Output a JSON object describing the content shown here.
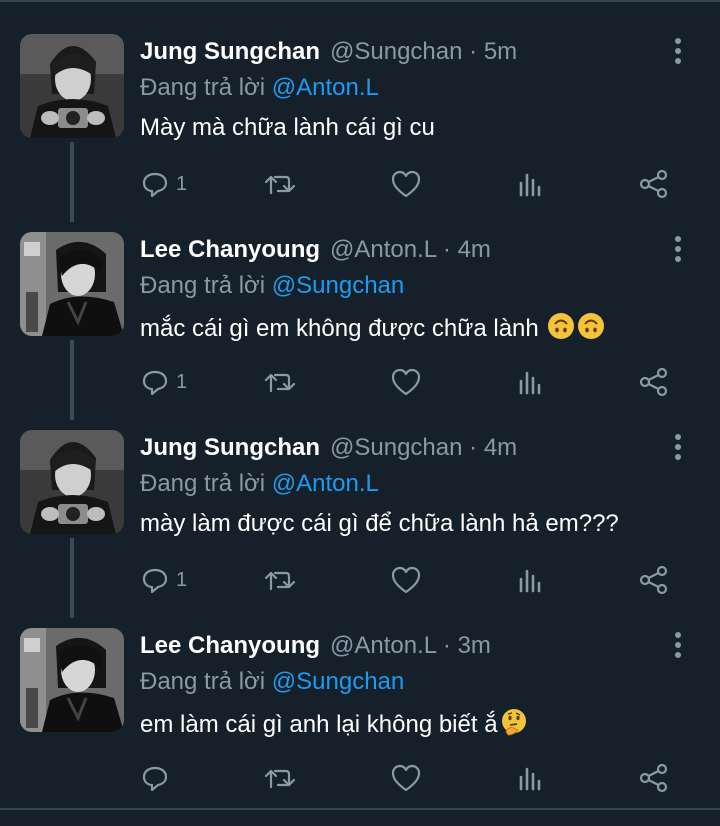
{
  "tweets": [
    {
      "name": "Jung Sungchan",
      "handle": "@Sungchan",
      "time": "5m",
      "reply_prefix": "Đang trả lời",
      "reply_to": "@Anton.L",
      "text": "Mày mà chữa lành cái gì cu",
      "reply_count": "1",
      "avatar": "person-with-camera"
    },
    {
      "name": "Lee Chanyoung",
      "handle": "@Anton.L",
      "time": "4m",
      "reply_prefix": "Đang trả lời",
      "reply_to": "@Sungchan",
      "text": "mắc cái gì em không được chữa lành",
      "emojis": [
        "upside-down-face",
        "upside-down-face"
      ],
      "reply_count": "1",
      "avatar": "person-in-jacket"
    },
    {
      "name": "Jung Sungchan",
      "handle": "@Sungchan",
      "time": "4m",
      "reply_prefix": "Đang trả lời",
      "reply_to": "@Anton.L",
      "text": "mày làm được cái gì để chữa lành hả em???",
      "reply_count": "1",
      "avatar": "person-with-camera"
    },
    {
      "name": "Lee Chanyoung",
      "handle": "@Anton.L",
      "time": "3m",
      "reply_prefix": "Đang trả lời",
      "reply_to": "@Sungchan",
      "text": "em làm cái gì anh lại không biết ắ",
      "emojis": [
        "thinking-face"
      ],
      "reply_count": "",
      "avatar": "person-in-jacket"
    }
  ],
  "separator": "·",
  "colors": {
    "background": "#15202b",
    "muted": "#8b98a5",
    "accent": "#1d9bf0",
    "divider": "#38444d"
  },
  "icons": [
    "reply-icon",
    "retweet-icon",
    "like-icon",
    "views-icon",
    "share-icon",
    "more-icon"
  ]
}
